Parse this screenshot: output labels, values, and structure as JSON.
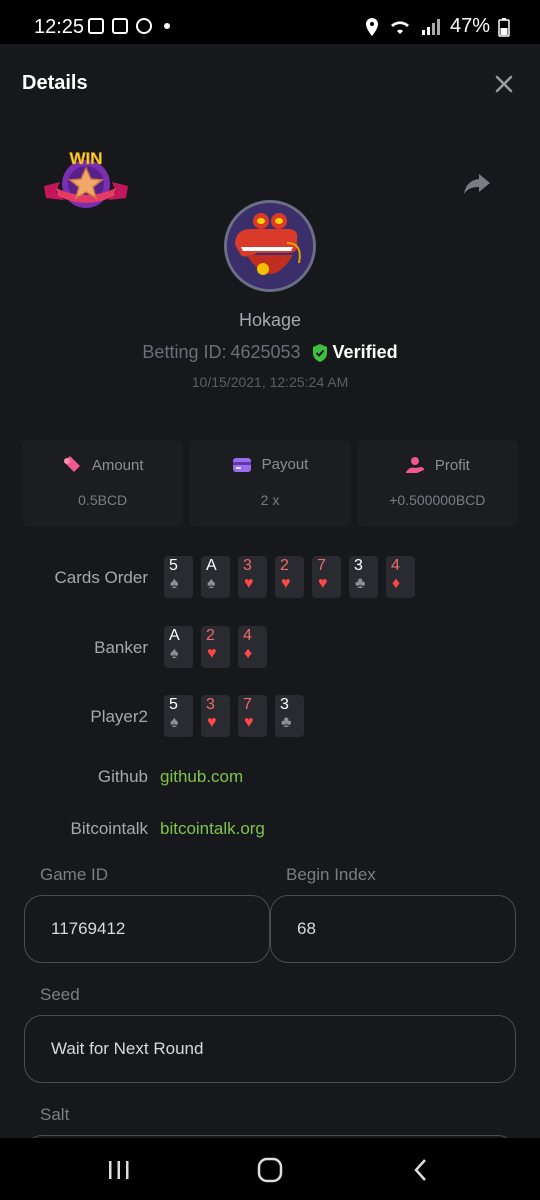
{
  "status_bar": {
    "time": "12:25",
    "battery": "47%"
  },
  "header": {
    "title": "Details"
  },
  "badge": {
    "text": "WIN"
  },
  "user": {
    "name": "Hokage",
    "betting_id_label": "Betting ID:",
    "betting_id": "4625053",
    "verified": "Verified",
    "timestamp": "10/15/2021, 12:25:24 AM"
  },
  "stats": [
    {
      "label": "Amount",
      "value": "0.5BCD"
    },
    {
      "label": "Payout",
      "value": "2 x"
    },
    {
      "label": "Profit",
      "value": "+0.500000BCD"
    }
  ],
  "rows": {
    "cards_order_label": "Cards Order",
    "banker_label": "Banker",
    "player_label": "Player2",
    "github_label": "Github",
    "github_link": "github.com",
    "bitcointalk_label": "Bitcointalk",
    "bitcointalk_link": "bitcointalk.org"
  },
  "cards_order": [
    {
      "rank": "5",
      "suit": "♠",
      "color": "black"
    },
    {
      "rank": "A",
      "suit": "♠",
      "color": "black"
    },
    {
      "rank": "3",
      "suit": "♥",
      "color": "red"
    },
    {
      "rank": "2",
      "suit": "♥",
      "color": "red"
    },
    {
      "rank": "7",
      "suit": "♥",
      "color": "red"
    },
    {
      "rank": "3",
      "suit": "♣",
      "color": "black"
    },
    {
      "rank": "4",
      "suit": "♦",
      "color": "red"
    }
  ],
  "banker_cards": [
    {
      "rank": "A",
      "suit": "♠",
      "color": "black"
    },
    {
      "rank": "2",
      "suit": "♥",
      "color": "red"
    },
    {
      "rank": "4",
      "suit": "♦",
      "color": "red"
    }
  ],
  "player_cards": [
    {
      "rank": "5",
      "suit": "♠",
      "color": "black"
    },
    {
      "rank": "3",
      "suit": "♥",
      "color": "red"
    },
    {
      "rank": "7",
      "suit": "♥",
      "color": "red"
    },
    {
      "rank": "3",
      "suit": "♣",
      "color": "black"
    }
  ],
  "fields": {
    "game_id_label": "Game ID",
    "game_id_value": "11769412",
    "begin_index_label": "Begin Index",
    "begin_index_value": "68",
    "seed_label": "Seed",
    "seed_value": "Wait for Next Round",
    "salt_label": "Salt"
  },
  "colors": {
    "background": "#17181b",
    "link": "#7ec44a",
    "verified_shield": "#3fbf3f",
    "red_suit": "#ff4747"
  }
}
